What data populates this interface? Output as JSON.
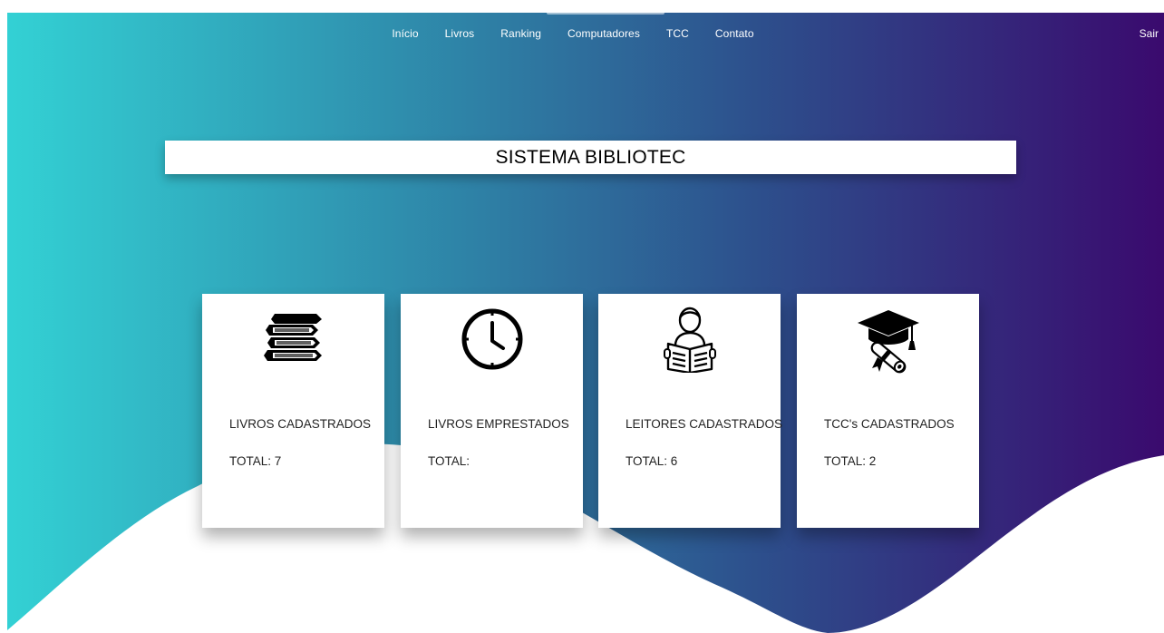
{
  "nav": {
    "items": [
      "Início",
      "Livros",
      "Ranking",
      "Computadores",
      "TCC",
      "Contato"
    ],
    "logout": "Sair"
  },
  "title": "SISTEMA BIBLIOTEC",
  "cards": [
    {
      "label": "LIVROS CADASTRADOS",
      "total": "TOTAL: 7",
      "icon": "books-stack-icon"
    },
    {
      "label": "LIVROS EMPRESTADOS",
      "total": "TOTAL:",
      "icon": "clock-icon"
    },
    {
      "label": "LEITORES CADASTRADOS",
      "total": "TOTAL: 6",
      "icon": "reader-icon"
    },
    {
      "label": "TCC's CADASTRADOS",
      "total": "TOTAL: 2",
      "icon": "graduation-cap-icon"
    }
  ],
  "colors": {
    "gradient_start": "#33d1d4",
    "gradient_mid": "#2e6a9a",
    "gradient_end": "#3a0a6e",
    "card_bg": "#ffffff"
  }
}
